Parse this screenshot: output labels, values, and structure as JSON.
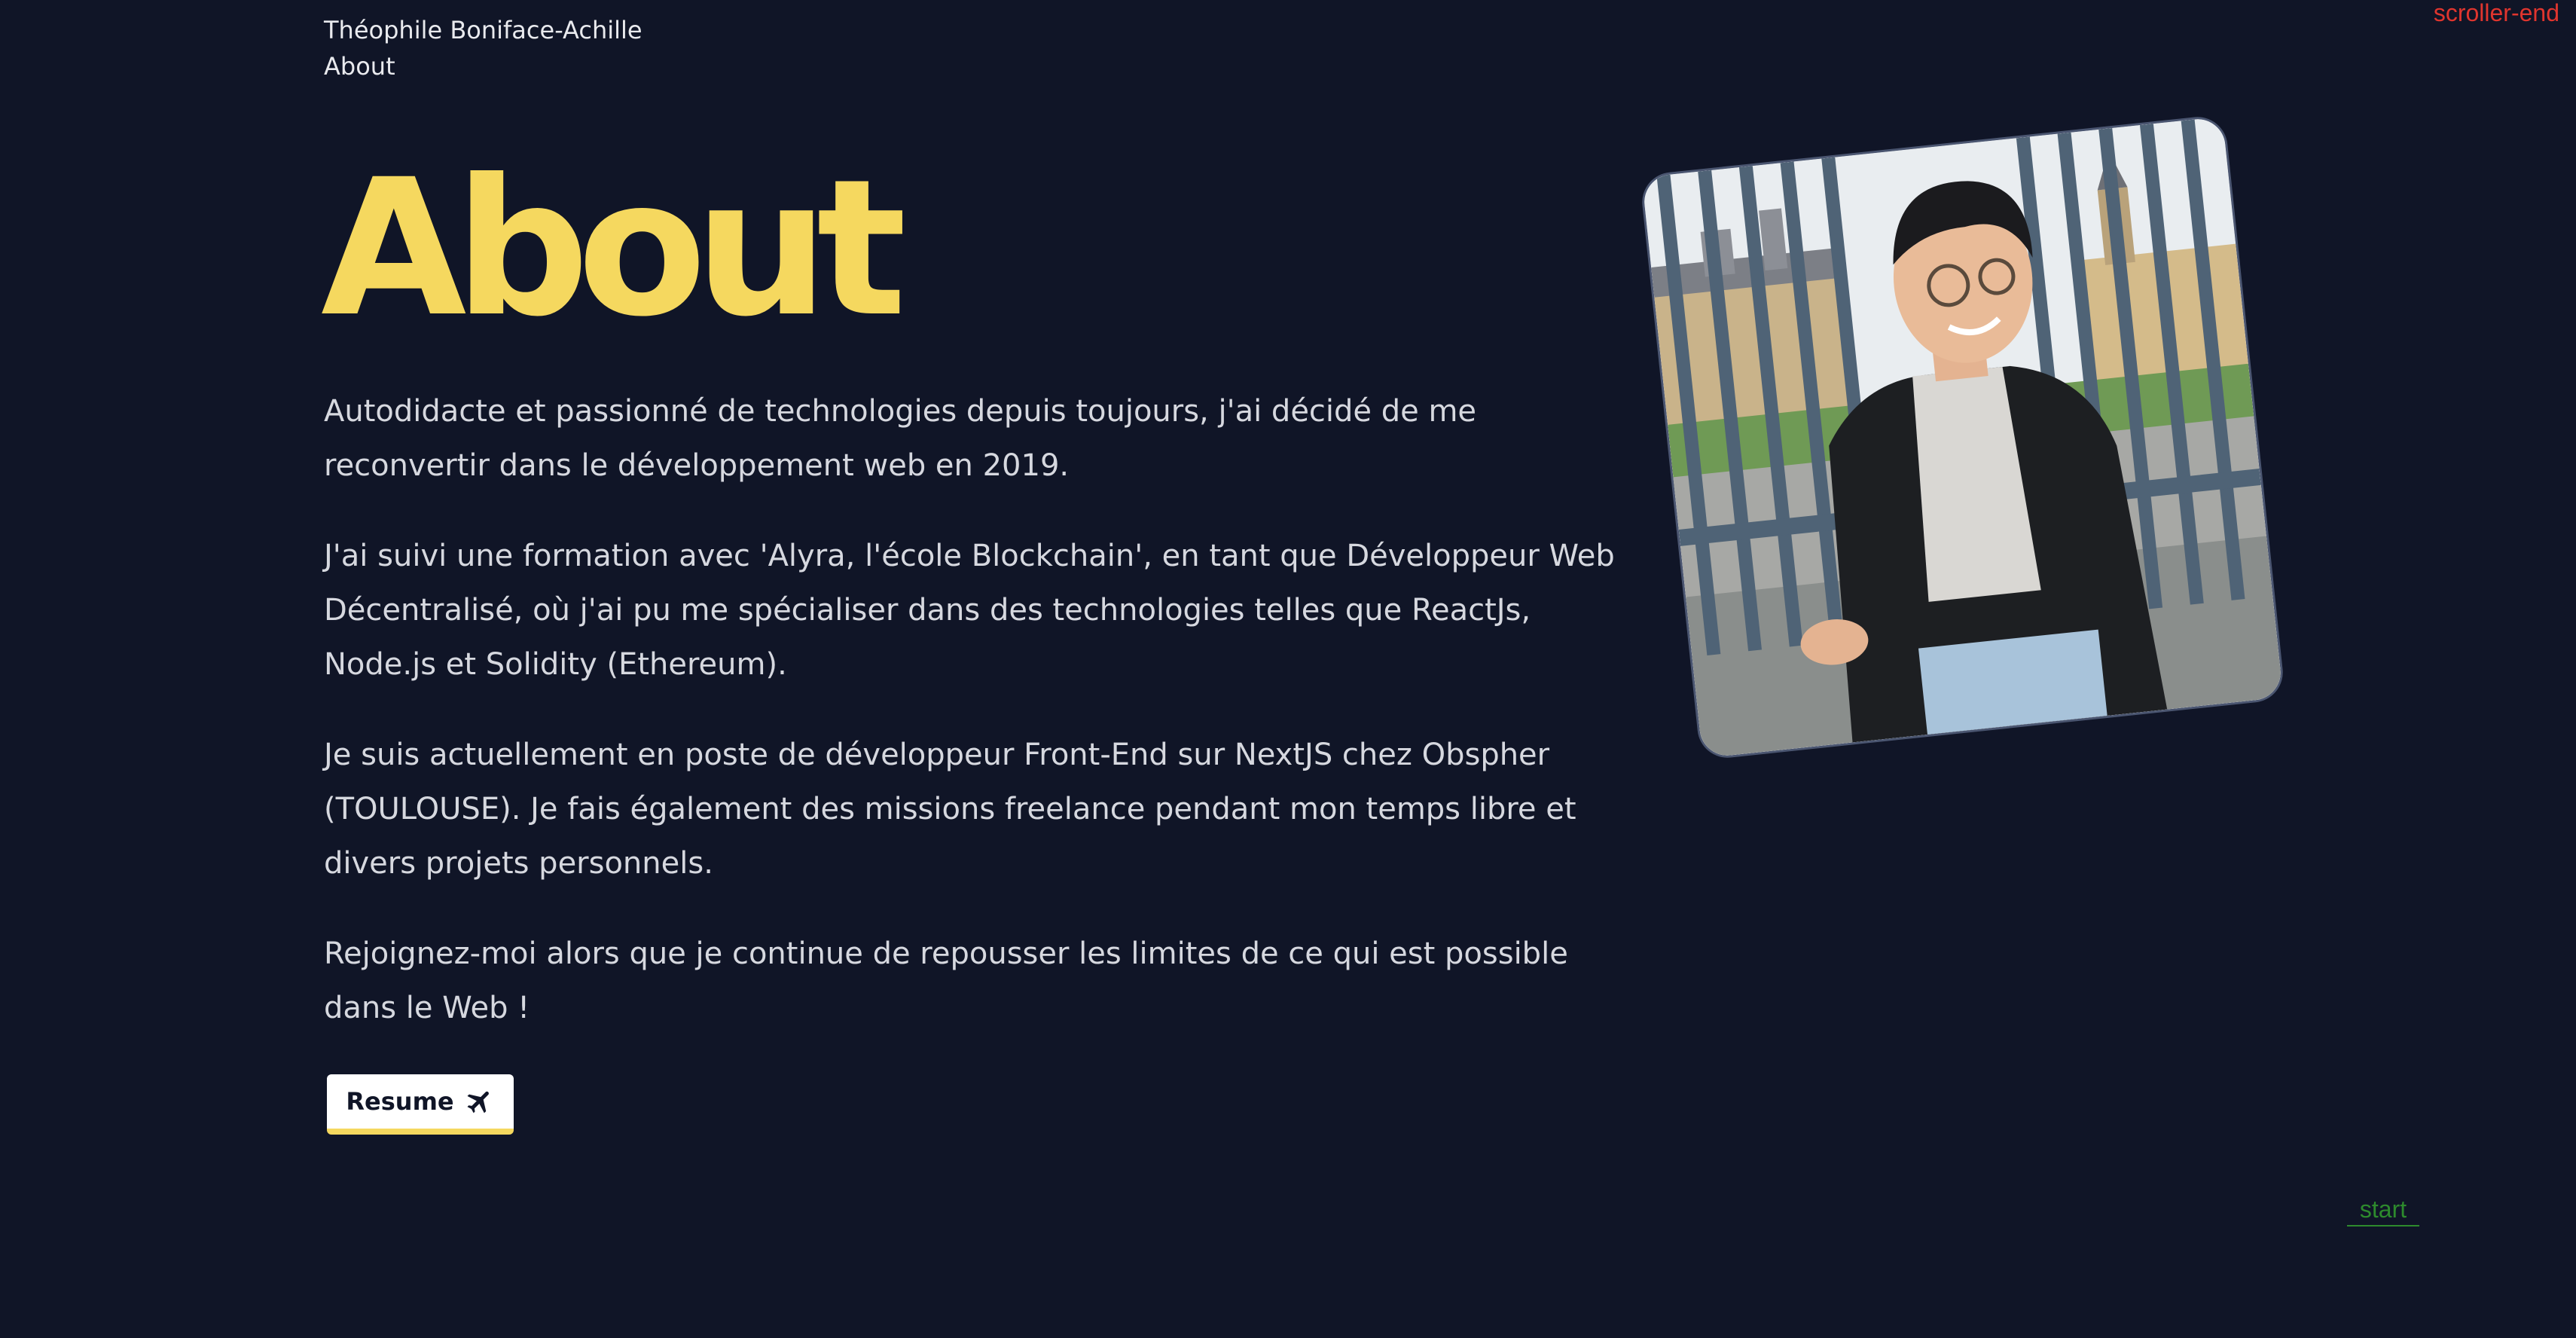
{
  "nav": {
    "name": "Théophile Boniface-Achille",
    "about": "About"
  },
  "debug": {
    "scroller_end": "scroller-end",
    "start": "start"
  },
  "section": {
    "title": "About",
    "paragraphs": [
      "Autodidacte et passionné de technologies depuis toujours, j'ai décidé de me reconvertir dans le développement web en 2019.",
      "J'ai suivi une formation avec 'Alyra, l'école Blockchain', en tant que Développeur Web Décentralisé, où j'ai pu me spécialiser dans des technologies telles que ReactJs, Node.js et Solidity (Ethereum).",
      "Je suis actuellement en poste de développeur Front-End sur NextJS chez Obspher (TOULOUSE). Je fais également des missions freelance pendant mon temps libre et divers projets personnels.",
      "Rejoignez-moi alors que je continue de repousser les limites de ce qui est possible dans le Web !"
    ],
    "resume_label": "Resume",
    "resume_icon": "airplane-icon"
  },
  "colors": {
    "background": "#101527",
    "accent": "#f5d85f",
    "text": "#d6d8df"
  }
}
